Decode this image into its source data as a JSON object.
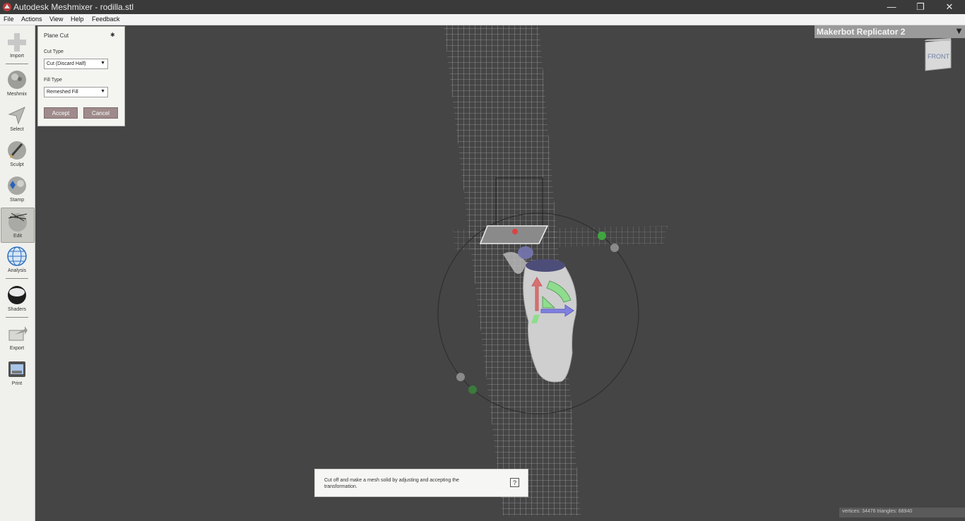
{
  "window": {
    "title": "Autodesk Meshmixer - rodilla.stl",
    "minimize": "—",
    "restore": "❐",
    "close": "✕"
  },
  "menu": [
    "File",
    "Actions",
    "View",
    "Help",
    "Feedback"
  ],
  "toolbar": {
    "items": [
      {
        "label": "Import",
        "icon": "plus-icon"
      },
      {
        "label": "Meshmix",
        "icon": "meshmix-sphere-icon"
      },
      {
        "label": "Select",
        "icon": "arrow-icon"
      },
      {
        "label": "Sculpt",
        "icon": "brush-icon"
      },
      {
        "label": "Stamp",
        "icon": "stamp-icon"
      },
      {
        "label": "Edit",
        "icon": "edit-sphere-icon"
      },
      {
        "label": "Analysis",
        "icon": "analysis-globe-icon"
      },
      {
        "label": "Shaders",
        "icon": "shader-sphere-icon"
      },
      {
        "label": "Export",
        "icon": "export-icon"
      },
      {
        "label": "Print",
        "icon": "printer-icon"
      }
    ],
    "active": "Edit"
  },
  "plane_cut": {
    "title": "Plane Cut",
    "cut_type_label": "Cut Type",
    "cut_type_value": "Cut (Discard Half)",
    "fill_type_label": "Fill Type",
    "fill_type_value": "Remeshed Fill",
    "accept": "Accept",
    "cancel": "Cancel"
  },
  "printer": {
    "name": "Makerbot Replicator 2"
  },
  "viewcube": {
    "face": "FRONT"
  },
  "help": {
    "text": "Cut off and make a mesh solid by adjusting and accepting the transformation.",
    "button": "?"
  },
  "status": {
    "stats": "vertices: 34476 triangles: 68940"
  },
  "colors": {
    "viewport": "#454545",
    "accent_button": "#9f8b8b",
    "gizmo_red": "#d9706f",
    "gizmo_green": "#8fdc8f",
    "gizmo_blue": "#8080e0"
  }
}
